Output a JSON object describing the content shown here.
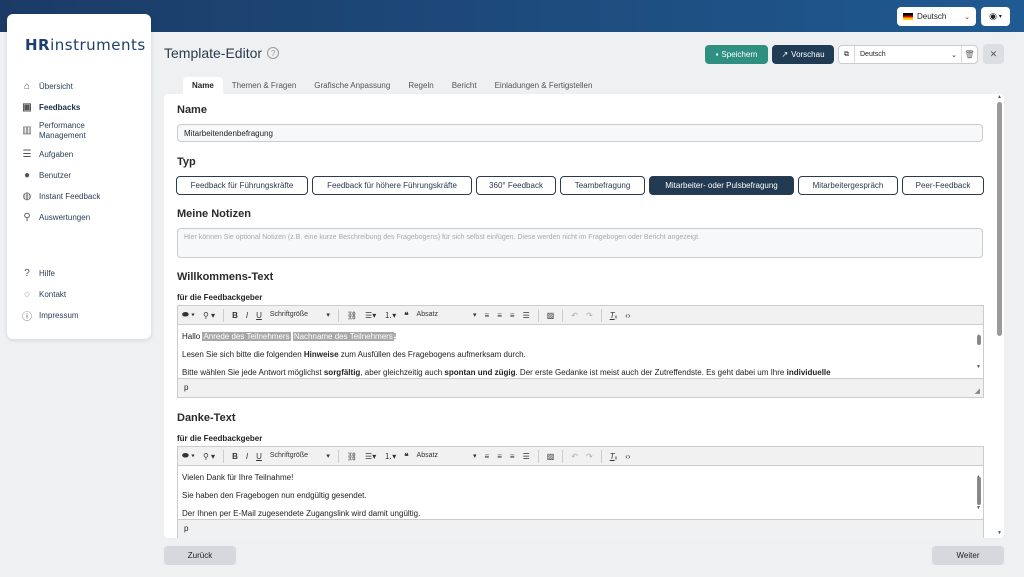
{
  "topbar": {
    "language": "Deutsch"
  },
  "sidebar": {
    "logo_prefix": "HR",
    "logo_suffix": "instruments",
    "items": [
      {
        "label": "Übersicht",
        "icon": "home-icon"
      },
      {
        "label": "Feedbacks",
        "icon": "clipboard-icon"
      },
      {
        "label": "Performance Management",
        "icon": "chart-icon"
      },
      {
        "label": "Aufgaben",
        "icon": "tasks-icon"
      },
      {
        "label": "Benutzer",
        "icon": "user-icon"
      },
      {
        "label": "Instant Feedback",
        "icon": "chat-icon"
      },
      {
        "label": "Auswertungen",
        "icon": "analysis-icon"
      }
    ],
    "bottom_items": [
      {
        "label": "Hilfe",
        "icon": "help-icon"
      },
      {
        "label": "Kontakt",
        "icon": "speech-icon"
      },
      {
        "label": "Impressum",
        "icon": "info-icon"
      }
    ]
  },
  "header": {
    "title": "Template-Editor",
    "save_label": "Speichern",
    "preview_label": "Vorschau",
    "language_select": "Deutsch"
  },
  "tabs": [
    "Name",
    "Themen & Fragen",
    "Grafische Anpassung",
    "Regeln",
    "Bericht",
    "Einladungen & Fertigstellen"
  ],
  "form": {
    "name_heading": "Name",
    "name_value": "Mitarbeitendenbefragung",
    "type_heading": "Typ",
    "types": [
      "Feedback für Führungskräfte",
      "Feedback für höhere Führungskräfte",
      "360° Feedback",
      "Teambefragung",
      "Mitarbeiter- oder Pulsbefragung",
      "Mitarbeitergespräch",
      "Peer-Feedback"
    ],
    "active_type": "Mitarbeiter- oder Pulsbefragung",
    "notes_heading": "Meine Notizen",
    "notes_placeholder": "Hier können Sie optional Notizen (z.B. eine kurze Beschreibung des Fragebogens) für sich selbst einfügen. Diese werden nicht im Fragebogen oder Bericht angezeigt.",
    "welcome_heading": "Willkommens-Text",
    "welcome_sub": "für die Feedbackgeber",
    "thanks_heading": "Danke-Text",
    "thanks_sub": "für die Feedbackgeber"
  },
  "toolbar": {
    "font_size": "Schriftgröße",
    "paragraph": "Absatz"
  },
  "welcome_editor": {
    "line1_a": "Hallo ",
    "placeholder1": "Anrede des Teilnehmers",
    "placeholder2": "Nachname des Teilnehmers",
    "line1_end": "!",
    "line2_a": "Lesen Sie sich bitte die folgenden ",
    "line2_b": "Hinweise",
    "line2_c": " zum Ausfüllen des Fragebogens aufmerksam durch.",
    "line3_a": "Bitte wählen Sie jede Antwort möglichst ",
    "line3_b": "sorgfältig",
    "line3_c": ", aber gleichzeitig auch ",
    "line3_d": "spontan und zügig",
    "line3_e": ". Der erste Gedanke ist meist auch der Zutreffendste. Es geht dabei um Ihre ",
    "line3_f": "individuelle",
    "status": "p"
  },
  "thanks_editor": {
    "line1": "Vielen Dank für Ihre Teilnahme!",
    "line2": "Sie haben den Fragebogen nun endgültig gesendet.",
    "line3": "Der Ihnen per E-Mail zugesendete Zugangslink wird damit ungültig.",
    "status": "p"
  },
  "footer": {
    "back_label": "Zurück",
    "next_label": "Weiter"
  }
}
